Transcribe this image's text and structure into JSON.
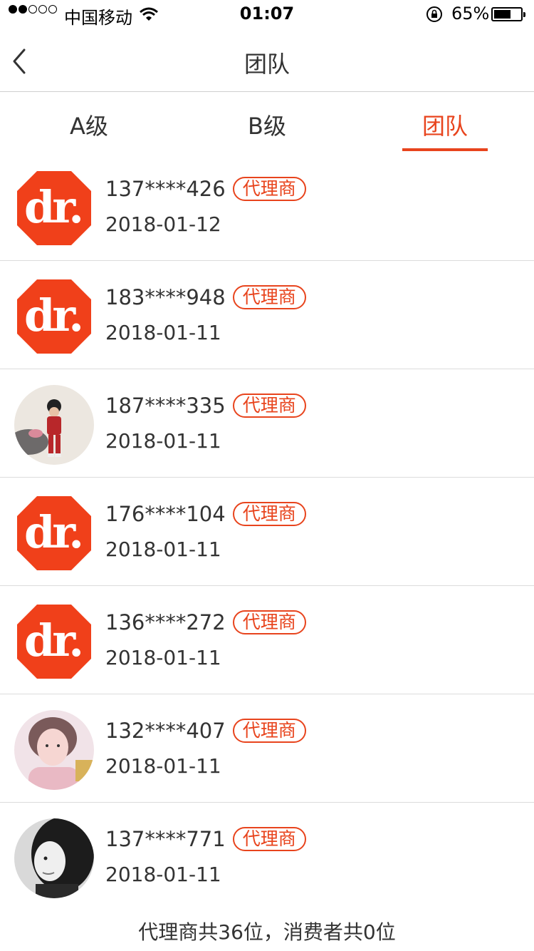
{
  "status_bar": {
    "carrier": "中国移动",
    "time": "01:07",
    "battery": "65%",
    "battery_level": 0.65
  },
  "nav": {
    "title": "团队"
  },
  "tabs": [
    {
      "label": "A级",
      "active": false
    },
    {
      "label": "B级",
      "active": false
    },
    {
      "label": "团队",
      "active": true
    }
  ],
  "members": [
    {
      "phone": "137****426",
      "tag": "代理商",
      "date": "2018-01-12",
      "avatar": "dr-logo"
    },
    {
      "phone": "183****948",
      "tag": "代理商",
      "date": "2018-01-11",
      "avatar": "dr-logo"
    },
    {
      "phone": "187****335",
      "tag": "代理商",
      "date": "2018-01-11",
      "avatar": "child-photo"
    },
    {
      "phone": "176****104",
      "tag": "代理商",
      "date": "2018-01-11",
      "avatar": "dr-logo"
    },
    {
      "phone": "136****272",
      "tag": "代理商",
      "date": "2018-01-11",
      "avatar": "dr-logo"
    },
    {
      "phone": "132****407",
      "tag": "代理商",
      "date": "2018-01-11",
      "avatar": "girl-photo"
    },
    {
      "phone": "137****771",
      "tag": "代理商",
      "date": "2018-01-11",
      "avatar": "bw-portrait-photo"
    }
  ],
  "summary": "代理商共36位，消费者共0位",
  "colors": {
    "accent": "#e8441d",
    "text": "#333333",
    "divider": "#dcdcdc"
  }
}
